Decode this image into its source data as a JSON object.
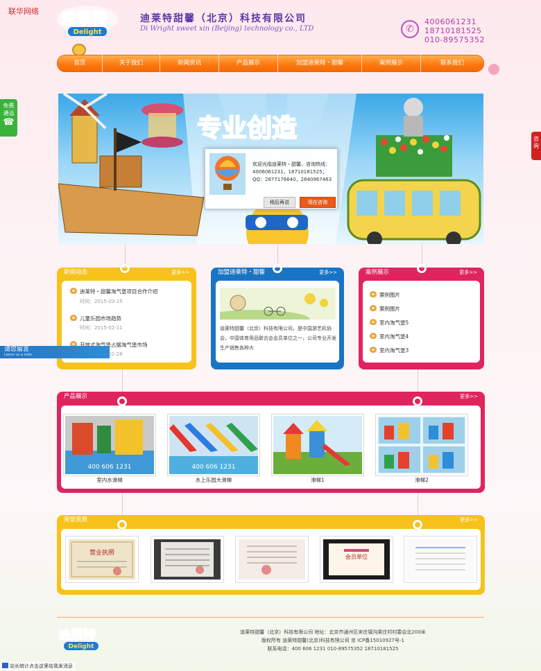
{
  "site_tag": "联华网络",
  "logo_text": "迪莱特",
  "logo_sub": "Delight",
  "company": {
    "name_cn": "迪莱特甜馨（北京）科技有限公司",
    "name_en": "Di Wright sweet xin (Beijing) technology co., LTD"
  },
  "phones": [
    "4006061231",
    "18710181525",
    "010-89575352"
  ],
  "nav": {
    "items": [
      "首页",
      "关于我们",
      "新闻资讯",
      "产品展示",
      "加盟迪莱特・甜馨",
      "案例展示",
      "联系我们"
    ]
  },
  "side": {
    "free_call": [
      "免费",
      "通话"
    ],
    "consult": "咨询",
    "message_title": "请您留言",
    "message_sub": "Leave us a note"
  },
  "banner": {
    "text": "专业创造"
  },
  "popup": {
    "text": "欢迎光临迪莱特・甜馨，咨询热线：4006061231，18710181525；QQ：2877176640，2840967463",
    "later": "稍后再说",
    "now": "现在咨询"
  },
  "news": {
    "title": "新闻动态",
    "more": "更多>>",
    "items": [
      {
        "title": "迪莱特・甜馨淘气堡项目合作介绍",
        "date": "时间：2015-03-25"
      },
      {
        "title": "儿童乐园市场趋势",
        "date": "时间：2015-02-11"
      },
      {
        "title": "开放式淘气堡占据淘气堡市场",
        "date": "时间：2015-01-28"
      }
    ]
  },
  "franchise": {
    "title": "加盟迪莱特・甜馨",
    "more": "更多>>",
    "desc": "迪莱特甜馨（北京）科技有限公司，是中国游艺机协会，中国体育用品联合会会员单位之一，公司专业开发生产销售各种大"
  },
  "cases": {
    "title": "案例展示",
    "more": "更多>>",
    "items": [
      "案例图片",
      "案例图片",
      "室内淘气堡5",
      "室内淘气堡4",
      "室内淘气堡3"
    ]
  },
  "products": {
    "title": "产品展示",
    "more": "更多>>",
    "items": [
      {
        "caption": "室内水滑梯",
        "overlay": "400 606 1231"
      },
      {
        "caption": "水上乐园大滑梯",
        "overlay": "400 606 1231"
      },
      {
        "caption": "滑梯1",
        "overlay": ""
      },
      {
        "caption": "滑梯2",
        "overlay": ""
      }
    ]
  },
  "honors": {
    "title": "荣誉资质",
    "more": "更多>>",
    "items": [
      "营业执照",
      "证书",
      "证明",
      "会员单位",
      "检测报告"
    ],
    "labels": [
      "营业执照",
      "",
      "",
      "会员单位",
      ""
    ]
  },
  "footer": {
    "line1": "迪莱特甜馨（北京）科技有限公司  地址：北京市通州区宋庄镇沟渠庄村村委会北200米",
    "line2": "版权所有 迪莱特甜馨(北京)科技有限公司 京 ICP备15010927号-1",
    "line3": "联系电话：400 606 1231 010-89575352 18710181525"
  },
  "stat_bar": "站长统计点击这里给我发消息",
  "colors": {
    "nav_orange": "#ff7a12",
    "news_yellow": "#f7c21c",
    "franchise_blue": "#1a74c4",
    "cases_pink": "#e0245e",
    "products_pink": "#e0245e",
    "honors_yellow": "#f7c21c",
    "brand_purple": "#5b35a8"
  }
}
